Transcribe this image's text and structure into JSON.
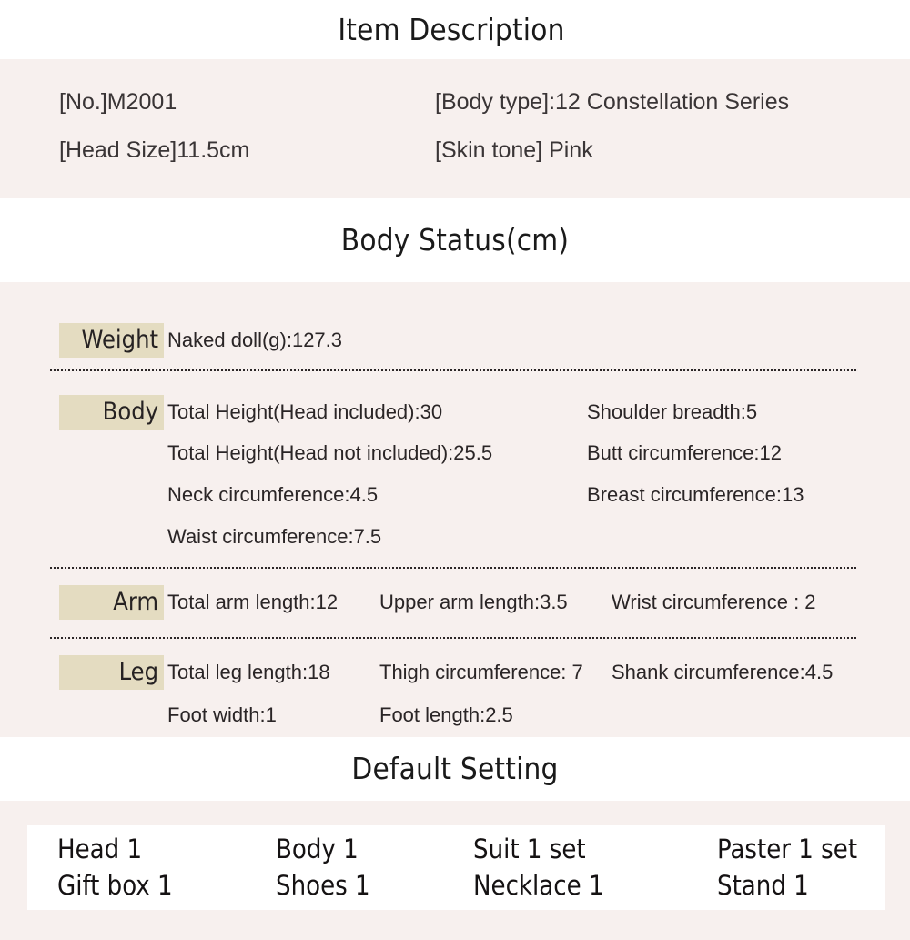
{
  "sections": {
    "item_description": {
      "heading": "Item Description",
      "fields": [
        {
          "label": "[No.]M2001"
        },
        {
          "label": "[Body type]:12 Constellation Series"
        },
        {
          "label": "[Head Size]11.5cm"
        },
        {
          "label": "[Skin tone] Pink"
        }
      ]
    },
    "body_status": {
      "heading": "Body Status(cm)",
      "rows": [
        {
          "tag": "Weight",
          "cells": [
            "Naked doll(g):127.3"
          ]
        },
        {
          "tag": "Body",
          "cells": [
            "Total Height(Head included):30",
            "Shoulder breadth:5",
            "Total Height(Head not included):25.5",
            "Butt circumference:12",
            "Neck circumference:4.5",
            "Breast circumference:13",
            "Waist circumference:7.5"
          ]
        },
        {
          "tag": "Arm",
          "cells": [
            "Total arm length:12",
            "Upper arm length:3.5",
            "Wrist circumference : 2"
          ]
        },
        {
          "tag": "Leg",
          "cells": [
            "Total leg length:18",
            "Thigh circumference: 7",
            "Shank circumference:4.5",
            "Foot width:1",
            "Foot length:2.5"
          ]
        }
      ]
    },
    "default_setting": {
      "heading": "Default Setting",
      "items": [
        "Head 1",
        "Body 1",
        "Suit 1 set",
        "Paster 1 set",
        "Gift box 1",
        "Shoes 1",
        "Necklace 1",
        "Stand 1"
      ]
    }
  },
  "colors": {
    "band_pink": "#f7f0ee",
    "band_white": "#ffffff",
    "tag_highlight": "#e4dcc1",
    "text": "#231f20"
  }
}
